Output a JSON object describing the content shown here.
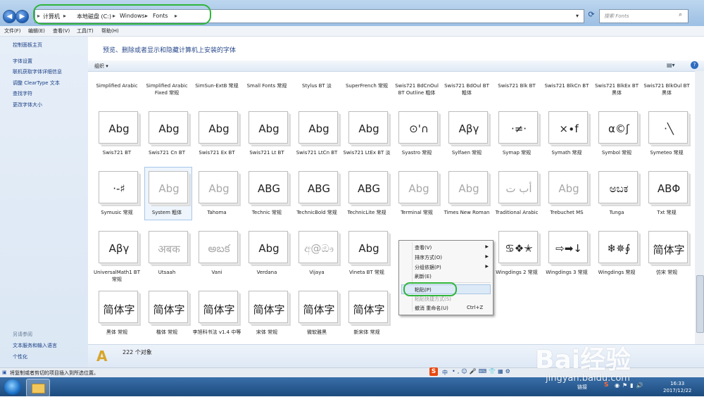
{
  "address": {
    "crumbs": [
      "计算机",
      "本地磁盘 (C:)",
      "Windows",
      "Fonts"
    ],
    "search_placeholder": "搜索 Fonts"
  },
  "menu": [
    "文件(F)",
    "编辑(E)",
    "查看(V)",
    "工具(T)",
    "帮助(H)"
  ],
  "left_links": [
    "控制面板主页",
    "字体设置",
    "联机获取字体详细信息",
    "调整 ClearType 文本",
    "查找字符",
    "更改字体大小"
  ],
  "see_also": {
    "title": "另请参阅",
    "items": [
      "文本服务和输入语言",
      "个性化"
    ]
  },
  "header": "预览、删除或者显示和隐藏计算机上安装的字体",
  "toolbar": {
    "organize": "组织 ▾"
  },
  "row0": [
    "Simplified Arabic",
    "Simplified Arabic Fixed 常规",
    "SimSun-ExtB 常规",
    "Small Fonts 常规",
    "Stylus BT 淡",
    "SuperFrench 常规",
    "Swis721 BdCnOul BT Outline 粗体",
    "Swis721 BdOul BT 粗体",
    "Swis721 Blk BT",
    "Swis721 BlkCn BT",
    "Swis721 BlkEx BT 黑体",
    "Swis721 BlkOul BT 黑体"
  ],
  "row1": [
    {
      "g": "Abg",
      "c": "Swis721 BT"
    },
    {
      "g": "Abg",
      "c": "Swis721 Cn BT"
    },
    {
      "g": "Abg",
      "c": "Swis721 Ex BT"
    },
    {
      "g": "Abg",
      "c": "Swis721 Lt BT"
    },
    {
      "g": "Abg",
      "c": "Swis721 LtCn BT"
    },
    {
      "g": "Abg",
      "c": "Swis721 LtEx BT 淡"
    },
    {
      "g": "⊙'∩",
      "c": "Syastro 常规"
    },
    {
      "g": "Αβγ",
      "c": "Sylfaen 常规"
    },
    {
      "g": "·≠·",
      "c": "Symap 常规"
    },
    {
      "g": "×∙f",
      "c": "Symath 常规"
    },
    {
      "g": "α©ʃ",
      "c": "Symbol 常规"
    },
    {
      "g": "·╲",
      "c": "Symeteo 常规"
    }
  ],
  "row2": [
    {
      "g": "·-♯",
      "c": "Symusic 常规"
    },
    {
      "g": "Abg",
      "c": "System 粗体"
    },
    {
      "g": "Abg",
      "c": "Tahoma"
    },
    {
      "g": "ABG",
      "c": "Technic 常规"
    },
    {
      "g": "ABG",
      "c": "TechnicBold 常规"
    },
    {
      "g": "ABG",
      "c": "TechnicLite 常规"
    },
    {
      "g": "Abg",
      "c": "Terminal 常规"
    },
    {
      "g": "Abg",
      "c": "Times New Roman"
    },
    {
      "g": "أب ت",
      "c": "Traditional Arabic"
    },
    {
      "g": "Abg",
      "c": "Trebuchet MS"
    },
    {
      "g": "ಅಬಕ",
      "c": "Tunga"
    },
    {
      "g": "ΑΒΦ",
      "c": "Txt 常规"
    }
  ],
  "row3": [
    {
      "g": "Αβγ",
      "c": "UniversalMath1 BT 常规"
    },
    {
      "g": "अबक",
      "c": "Utsaah"
    },
    {
      "g": "అబక",
      "c": "Vani"
    },
    {
      "g": "Abg",
      "c": "Verdana"
    },
    {
      "g": "අ@ඖ",
      "c": "Vijaya"
    },
    {
      "g": "Abg",
      "c": "Vineta BT 常规"
    },
    {
      "g": "",
      "c": ""
    },
    {
      "g": "",
      "c": ""
    },
    {
      "g": "♋❖✭",
      "c": "Wingdings 2 常规"
    },
    {
      "g": "⇨➡↓",
      "c": "Wingdings 3 常规"
    },
    {
      "g": "❄✵∮",
      "c": "Wingdings 常规"
    },
    {
      "g": "简体字",
      "c": "仿宋 常规"
    }
  ],
  "row4": [
    {
      "g": "简体字",
      "c": "黑体 常规"
    },
    {
      "g": "简体字",
      "c": "楷体 常规"
    },
    {
      "g": "简体字",
      "c": "李旭科书法 v1.4 中等"
    },
    {
      "g": "简体字",
      "c": "宋体 常规"
    },
    {
      "g": "简体字",
      "c": "微软雅黑"
    },
    {
      "g": "简体字",
      "c": "新宋体 常规"
    }
  ],
  "context_menu": {
    "view": "查看(V)",
    "sort": "排序方式(O)",
    "group": "分组依据(P)",
    "refresh": "刷新(E)",
    "paste": "粘贴(P)",
    "paste_shortcut": "粘贴快捷方式(S)",
    "undo": "撤消 重命名(U)",
    "undo_key": "Ctrl+Z"
  },
  "details": {
    "count": "222 个对象"
  },
  "status": "将复制或者剪切的项目插入到所选位置。",
  "tray": {
    "link": "链接",
    "time": "16:33",
    "date": "2017/12/22"
  },
  "ime": {
    "lang": "中"
  },
  "watermark": {
    "brand": "Bai经验",
    "url": "jingyan.baidu.com"
  }
}
